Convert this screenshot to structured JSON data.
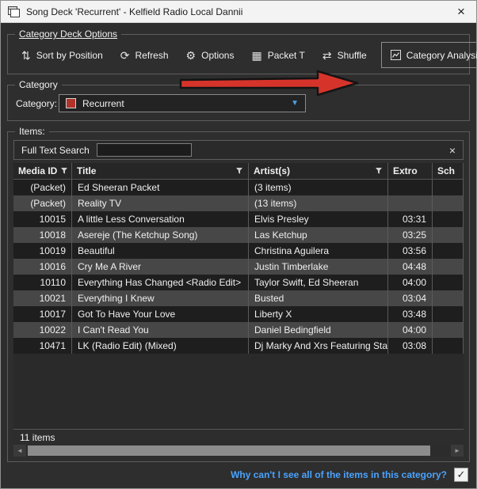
{
  "window": {
    "title": "Song Deck 'Recurrent' - Kelfield Radio Local Dannii",
    "close_icon": "×"
  },
  "deck_options": {
    "legend": "Category Deck Options",
    "sort_button": "Sort by Position",
    "refresh_button": "Refresh",
    "options_button": "Options",
    "packet_button": "Packet T",
    "shuffle_button": "Shuffle",
    "analysis_button": "Category Analysis",
    "icons": {
      "sort": "⇅",
      "refresh": "⟳",
      "options": "⚙",
      "packet": "▦",
      "shuffle": "⇄"
    }
  },
  "category": {
    "legend": "Category",
    "label": "Category:",
    "selected": "Recurrent",
    "swatch_color": "#b2332a",
    "dropdown_arrow": "▼"
  },
  "items": {
    "legend": "Items:",
    "search": {
      "label": "Full Text Search",
      "value": "",
      "clear_icon": "×"
    },
    "table": {
      "columns": [
        "Media ID",
        "Title",
        "Artist(s)",
        "Extro",
        "Sch"
      ],
      "rows": [
        {
          "media_id": "(Packet)",
          "title": "Ed Sheeran Packet",
          "artist": "(3 items)",
          "extro": ""
        },
        {
          "media_id": "(Packet)",
          "title": "Reality TV",
          "artist": "(13 items)",
          "extro": ""
        },
        {
          "media_id": "10015",
          "title": "A little Less Conversation",
          "artist": "Elvis Presley",
          "extro": "03:31"
        },
        {
          "media_id": "10018",
          "title": "Asereje (The Ketchup Song)",
          "artist": "Las Ketchup",
          "extro": "03:25"
        },
        {
          "media_id": "10019",
          "title": "Beautiful",
          "artist": "Christina Aguilera",
          "extro": "03:56"
        },
        {
          "media_id": "10016",
          "title": "Cry Me A River",
          "artist": "Justin Timberlake",
          "extro": "04:48"
        },
        {
          "media_id": "10110",
          "title": "Everything Has Changed <Radio Edit>",
          "artist": "Taylor Swift, Ed Sheeran",
          "extro": "04:00"
        },
        {
          "media_id": "10021",
          "title": "Everything I Knew",
          "artist": "Busted",
          "extro": "03:04"
        },
        {
          "media_id": "10017",
          "title": "Got To Have Your Love",
          "artist": "Liberty X",
          "extro": "03:48"
        },
        {
          "media_id": "10022",
          "title": "I Can't Read You",
          "artist": "Daniel Bedingfield",
          "extro": "04:00"
        },
        {
          "media_id": "10471",
          "title": "LK (Radio Edit) (Mixed)",
          "artist": "Dj Marky And Xrs Featuring Stamina",
          "extro": "03:08"
        }
      ]
    },
    "status": "11 items",
    "scrollbar": {
      "left_arrow": "◄",
      "right_arrow": "►"
    }
  },
  "footer": {
    "link": "Why can't I see all of the items in this category?",
    "check_icon": "✓"
  },
  "colors": {
    "annotation_arrow": "#d6342b",
    "link_blue": "#4aa3ff",
    "swatch_red": "#b2332a",
    "titlebar_bg": "#f3f3f3"
  }
}
